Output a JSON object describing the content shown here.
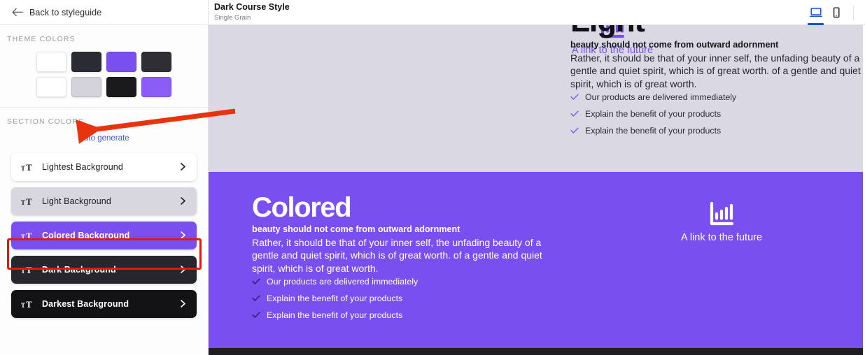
{
  "sidebar": {
    "back": {
      "label": "Back to styleguide",
      "icon": "arrow-left-icon"
    },
    "theme_colors": {
      "title": "THEME COLORS",
      "row1": [
        "#ffffff",
        "#2b2b33",
        "#7a4ff0",
        "#2e2e34"
      ],
      "row2": [
        "#ffffff",
        "#d4d3dc",
        "#1a1a1d",
        "#8b5cf6"
      ]
    },
    "section_colors": {
      "title": "SECTION COLORS",
      "auto_generate": "Auto generate",
      "items": [
        {
          "label": "Lightest Background",
          "icon": "text-size-icon",
          "chevron": "chevron-right-icon",
          "bg": "#ffffff",
          "selected": false
        },
        {
          "label": "Light Background",
          "icon": "text-size-icon",
          "chevron": "chevron-right-icon",
          "bg": "#d8d7e0",
          "selected": false
        },
        {
          "label": "Colored Background",
          "icon": "text-size-icon",
          "chevron": "chevron-right-icon",
          "bg": "#7a4ff0",
          "selected": true
        },
        {
          "label": "Dark Background",
          "icon": "text-size-icon",
          "chevron": "chevron-right-icon",
          "bg": "#26262c",
          "selected": false
        },
        {
          "label": "Darkest Background",
          "icon": "text-size-icon",
          "chevron": "chevron-right-icon",
          "bg": "#131316",
          "selected": false
        }
      ]
    }
  },
  "preview": {
    "header": {
      "title": "Dark Course Style",
      "subtitle": "Single Grain",
      "devices": [
        {
          "name": "desktop",
          "icon": "desktop-icon",
          "active": true
        },
        {
          "name": "mobile",
          "icon": "mobile-icon",
          "active": false
        }
      ]
    },
    "sections": [
      {
        "id": "light",
        "heading": "Light",
        "lead": "beauty should not come from outward adornment",
        "paragraph": "Rather, it should be that of your inner self, the unfading beauty of a gentle and quiet spirit, which is of great worth. of a gentle and quiet spirit, which is of great worth.",
        "checklist": [
          "Our products are delivered immediately",
          "Explain the benefit of your products",
          "Explain the benefit of your products"
        ],
        "link": {
          "text": "A link to the future",
          "icon": "bar-chart-icon"
        },
        "background": "#dad8e3"
      },
      {
        "id": "colored",
        "heading": "Colored",
        "lead": "beauty should not come from outward adornment",
        "paragraph": "Rather, it should be that of your inner self, the unfading beauty of a gentle and quiet spirit, which is of great worth. of a gentle and quiet spirit, which is of great worth.",
        "checklist": [
          "Our products are delivered immediately",
          "Explain the benefit of your products",
          "Explain the benefit of your products"
        ],
        "link": {
          "text": "A link to the future",
          "icon": "bar-chart-icon"
        },
        "background": "#7a4ff0"
      }
    ]
  },
  "annotations": {
    "arrow": {
      "name": "red-arrow-annotation",
      "color": "#e8340c",
      "points_to": "SECTION COLORS"
    },
    "highlight_box": {
      "name": "red-highlight-box-annotation",
      "color": "#e01b0c",
      "targets": "Colored Background"
    }
  }
}
